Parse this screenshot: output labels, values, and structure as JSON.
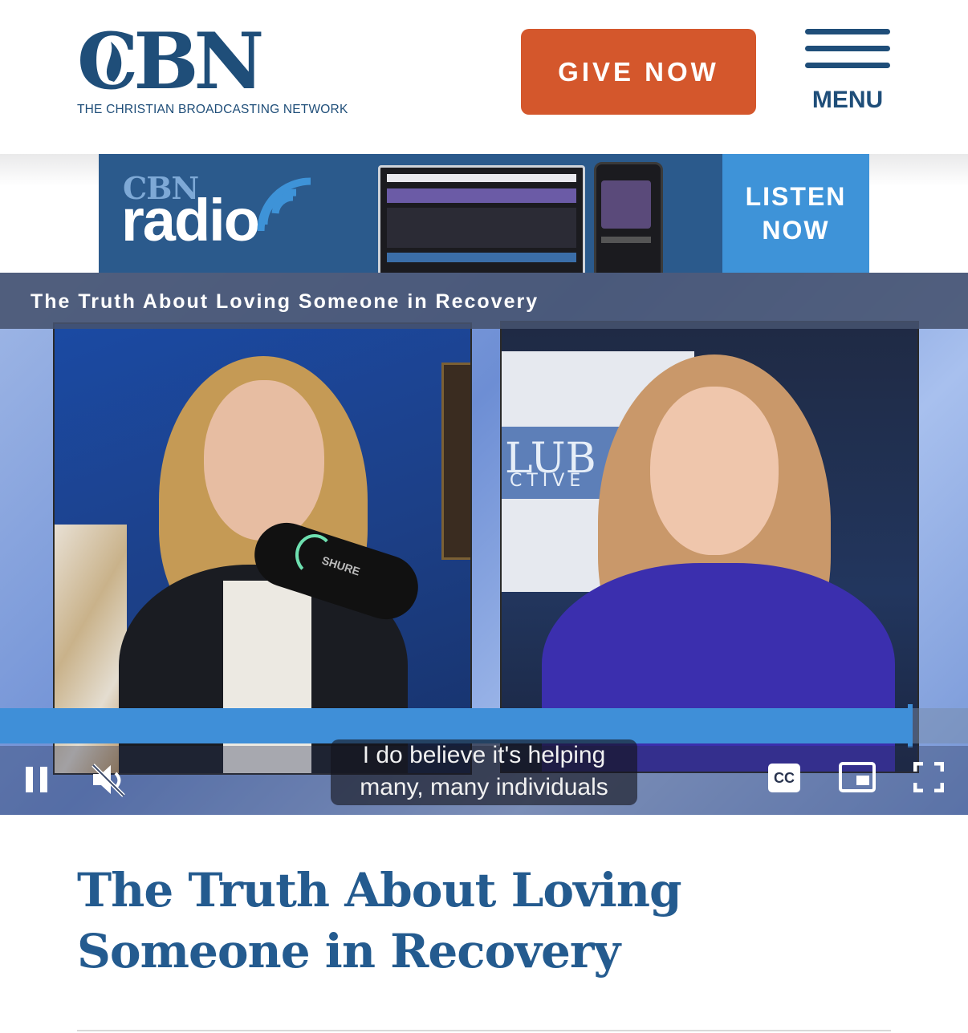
{
  "header": {
    "logo_text": "CBN",
    "tagline": "THE CHRISTIAN BROADCASTING NETWORK",
    "give_button": "GIVE NOW",
    "menu_label": "MENU"
  },
  "banner": {
    "brand_small": "CBN",
    "brand_word": "radio",
    "cta_line1": "LISTEN",
    "cta_line2": "NOW"
  },
  "video": {
    "title": "The Truth About Loving Someone in Recovery",
    "caption_line1": "I do believe it's helping",
    "caption_line2": "many, many individuals",
    "backdrop_sign": "LUB",
    "backdrop_sign_sub": "CTIVE",
    "mic_label": "SHURE",
    "progress_fraction": 0.94,
    "cc_label": "CC"
  },
  "article": {
    "title": "The Truth About Loving Someone in Recovery"
  },
  "colors": {
    "brand_blue": "#1f4e79",
    "give_orange": "#d4572c",
    "listen_blue": "#3e93d8",
    "progress_blue": "#3f8fd8"
  }
}
